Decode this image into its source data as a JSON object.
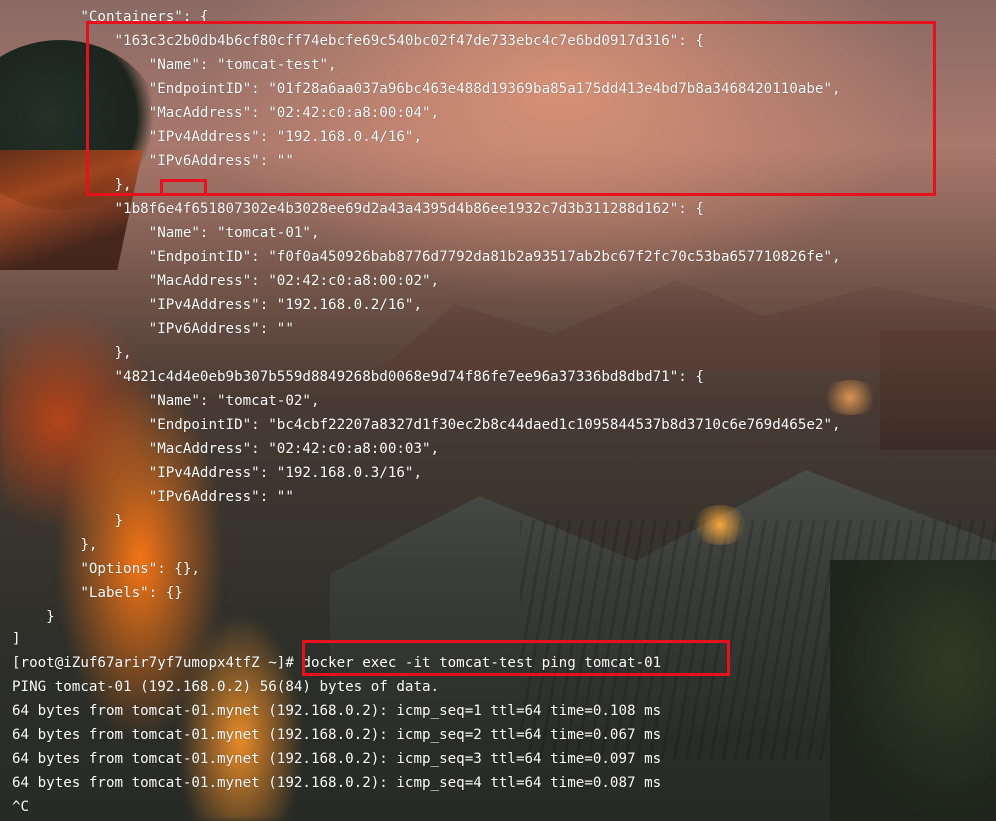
{
  "terminal": {
    "lines": [
      "        \"Containers\": {",
      "            \"163c3c2b0db4b6cf80cff74ebcfe69c540bc02f47de733ebc4c7e6bd0917d316\": {",
      "                \"Name\": \"tomcat-test\",",
      "                \"EndpointID\": \"01f28a6aa037a96bc463e488d19369ba85a175dd413e4bd7b8a3468420110abe\",",
      "                \"MacAddress\": \"02:42:c0:a8:00:04\",",
      "                \"IPv4Address\": \"192.168.0.4/16\",",
      "                \"IPv6Address\": \"\"",
      "            },",
      "            \"1b8f6e4f651807302e4b3028ee69d2a43a4395d4b86ee1932c7d3b311288d162\": {",
      "                \"Name\": \"tomcat-01\",",
      "                \"EndpointID\": \"f0f0a450926bab8776d7792da81b2a93517ab2bc67f2fc70c53ba657710826fe\",",
      "                \"MacAddress\": \"02:42:c0:a8:00:02\",",
      "                \"IPv4Address\": \"192.168.0.2/16\",",
      "                \"IPv6Address\": \"\"",
      "            },",
      "            \"4821c4d4e0eb9b307b559d8849268bd0068e9d74f86fe7ee96a37336bd8dbd71\": {",
      "                \"Name\": \"tomcat-02\",",
      "                \"EndpointID\": \"bc4cbf22207a8327d1f30ec2b8c44daed1c1095844537b8d3710c6e769d465e2\",",
      "                \"MacAddress\": \"02:42:c0:a8:00:03\",",
      "                \"IPv4Address\": \"192.168.0.3/16\",",
      "                \"IPv6Address\": \"\"",
      "            }",
      "        },",
      "        \"Options\": {},",
      "        \"Labels\": {}",
      "    }",
      "]",
      "[root@iZuf67arir7yf7umopx4tfZ ~]# docker exec -it tomcat-test ping tomcat-01",
      "PING tomcat-01 (192.168.0.2) 56(84) bytes of data.",
      "64 bytes from tomcat-01.mynet (192.168.0.2): icmp_seq=1 ttl=64 time=0.108 ms",
      "64 bytes from tomcat-01.mynet (192.168.0.2): icmp_seq=2 ttl=64 time=0.067 ms",
      "64 bytes from tomcat-01.mynet (192.168.0.2): icmp_seq=3 ttl=64 time=0.097 ms",
      "64 bytes from tomcat-01.mynet (192.168.0.2): icmp_seq=4 ttl=64 time=0.087 ms",
      "^C"
    ]
  },
  "colors": {
    "highlight": "#e8101c",
    "text": "#ffffff"
  }
}
